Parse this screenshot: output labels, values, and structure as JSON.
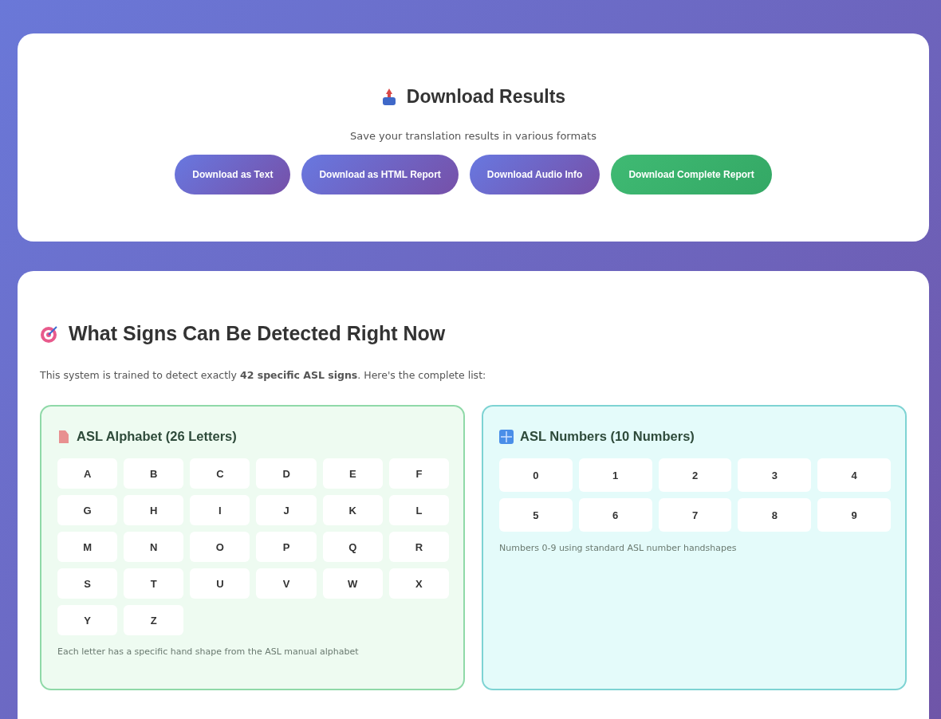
{
  "download": {
    "title": "Download Results",
    "subtitle": "Save your translation results in various formats",
    "buttons": [
      {
        "label": "Download as Text",
        "kind": "primary"
      },
      {
        "label": "Download as HTML Report",
        "kind": "primary"
      },
      {
        "label": "Download Audio Info",
        "kind": "primary"
      },
      {
        "label": "Download Complete Report",
        "kind": "success"
      }
    ]
  },
  "signs": {
    "title": "What Signs Can Be Detected Right Now",
    "intro": "This system is trained to detect exactly **42 specific ASL signs**. Here's the complete list:",
    "groups": [
      {
        "kind": "letters",
        "title": "ASL Alphabet (26 Letters)",
        "items": [
          "A",
          "B",
          "C",
          "D",
          "E",
          "F",
          "G",
          "H",
          "I",
          "J",
          "K",
          "L",
          "M",
          "N",
          "O",
          "P",
          "Q",
          "R",
          "S",
          "T",
          "U",
          "V",
          "W",
          "X",
          "Y",
          "Z"
        ],
        "note": "Each letter has a specific hand shape from the ASL manual alphabet"
      },
      {
        "kind": "numbers",
        "title": "ASL Numbers (10 Numbers)",
        "items": [
          "0",
          "1",
          "2",
          "3",
          "4",
          "5",
          "6",
          "7",
          "8",
          "9"
        ],
        "note": "Numbers 0-9 using standard ASL number handshapes"
      }
    ]
  }
}
